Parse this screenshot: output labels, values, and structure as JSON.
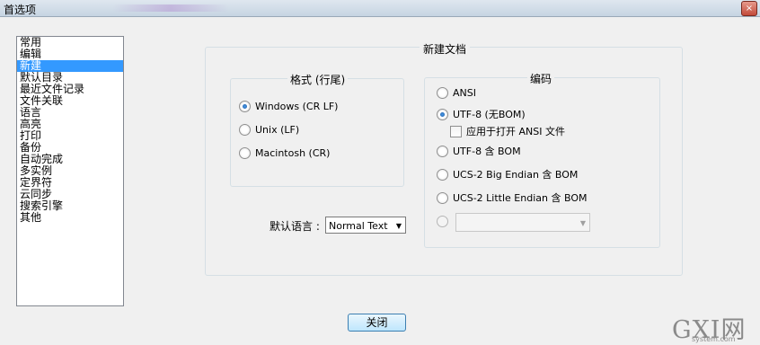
{
  "window": {
    "title": "首选项",
    "close_glyph": "×"
  },
  "sidebar": {
    "items": [
      {
        "label": "常用",
        "selected": false
      },
      {
        "label": "编辑",
        "selected": false
      },
      {
        "label": "新建",
        "selected": true
      },
      {
        "label": "默认目录",
        "selected": false
      },
      {
        "label": "最近文件记录",
        "selected": false
      },
      {
        "label": "文件关联",
        "selected": false
      },
      {
        "label": "语言",
        "selected": false
      },
      {
        "label": "高亮",
        "selected": false
      },
      {
        "label": "打印",
        "selected": false
      },
      {
        "label": "备份",
        "selected": false
      },
      {
        "label": "自动完成",
        "selected": false
      },
      {
        "label": "多实例",
        "selected": false
      },
      {
        "label": "定界符",
        "selected": false
      },
      {
        "label": "云同步",
        "selected": false
      },
      {
        "label": "搜索引擎",
        "selected": false
      },
      {
        "label": "其他",
        "selected": false
      }
    ]
  },
  "new_document": {
    "title": "新建文档",
    "format": {
      "title": "格式 (行尾)",
      "options": [
        {
          "label": "Windows (CR LF)",
          "checked": true
        },
        {
          "label": "Unix (LF)",
          "checked": false
        },
        {
          "label": "Macintosh (CR)",
          "checked": false
        }
      ]
    },
    "encoding": {
      "title": "编码",
      "options": [
        {
          "label": "ANSI",
          "checked": false
        },
        {
          "label": "UTF-8 (无BOM)",
          "checked": true
        },
        {
          "label": "UTF-8 含 BOM",
          "checked": false
        },
        {
          "label": "UCS-2 Big Endian 含 BOM",
          "checked": false
        },
        {
          "label": "UCS-2 Little Endian 含 BOM",
          "checked": false
        }
      ],
      "apply_ansi_label": "应用于打开 ANSI 文件",
      "apply_ansi_checked": false,
      "other_encoding_value": ""
    },
    "default_language": {
      "label": "默认语言 :",
      "value": "Normal Text"
    }
  },
  "footer": {
    "close_label": "关闭"
  },
  "watermark": {
    "main": "GXI网",
    "sub": "system.com"
  },
  "colors": {
    "selection": "#3399ff",
    "accent_radio": "#1b5aa7"
  }
}
